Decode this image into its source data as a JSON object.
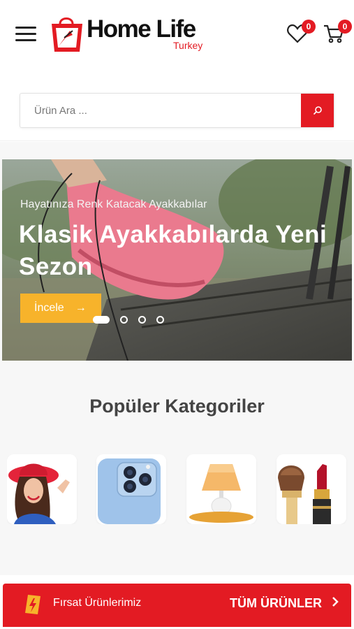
{
  "header": {
    "logo_title": "Home Life",
    "logo_subtitle": "Turkey",
    "wishlist_count": "0",
    "cart_count": "0"
  },
  "search": {
    "placeholder": "Ürün Ara ..."
  },
  "hero": {
    "subtitle": "Hayatınıza Renk Katacak Ayakkabılar",
    "title": "Klasik Ayakkabılarda Yeni Sezon",
    "button_label": "İncele",
    "button_arrow": "→",
    "slide_count": 4,
    "active_slide": 1
  },
  "categories": {
    "title": "Popüler Kategoriler",
    "items": [
      {
        "icon": "woman-red-hat"
      },
      {
        "icon": "blue-smartphone"
      },
      {
        "icon": "table-lamp"
      },
      {
        "icon": "makeup-brush-lipstick"
      }
    ]
  },
  "deals": {
    "label": "Fırsat Ürünlerimiz",
    "all_label": "TÜM ÜRÜNLER",
    "chevron": "›"
  },
  "colors": {
    "brand_red": "#e31b23",
    "accent_yellow": "#f7b32b"
  }
}
